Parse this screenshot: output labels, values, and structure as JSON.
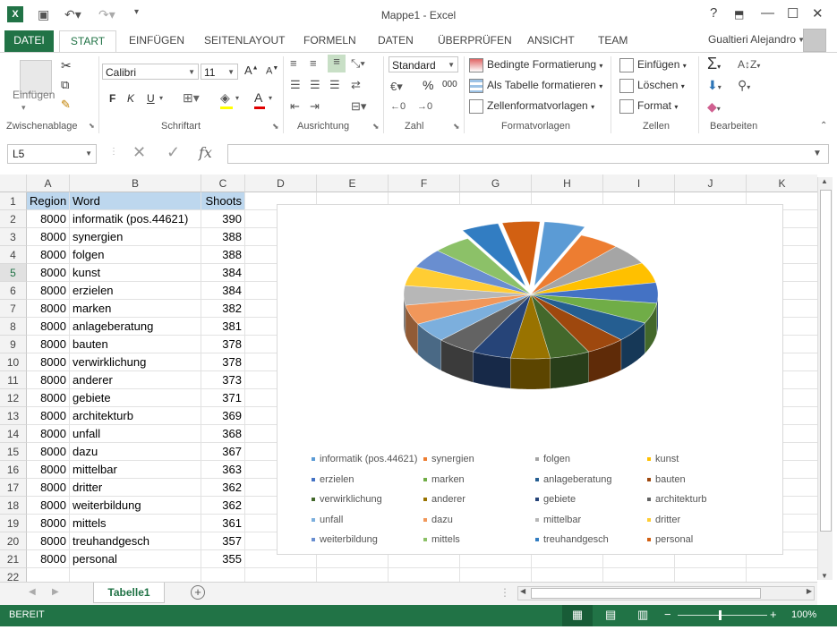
{
  "window": {
    "title": "Mappe1 - Excel",
    "user": "Gualtieri Alejandro",
    "help": "?",
    "min": "—",
    "max": "☐",
    "close": "✕"
  },
  "tabs": [
    "DATEI",
    "START",
    "EINFÜGEN",
    "SEITENLAYOUT",
    "FORMELN",
    "DATEN",
    "ÜBERPRÜFEN",
    "ANSICHT",
    "TEAM"
  ],
  "ribbon": {
    "paste_label": "Einfügen",
    "font_name": "Calibri",
    "font_size": "11",
    "bold": "F",
    "italic": "K",
    "underline": "U",
    "number_format": "Standard",
    "percent": "%",
    "thousands": "000",
    "cond_format": "Bedingte Formatierung",
    "as_table": "Als Tabelle formatieren",
    "cell_styles": "Zellenformatvorlagen",
    "insert": "Einfügen",
    "delete": "Löschen",
    "format": "Format",
    "groups": {
      "clipboard": "Zwischenablage",
      "font": "Schriftart",
      "alignment": "Ausrichtung",
      "number": "Zahl",
      "styles": "Formatvorlagen",
      "cells": "Zellen",
      "editing": "Bearbeiten"
    }
  },
  "formula_bar": {
    "name_box": "L5",
    "fx": "fx",
    "value": ""
  },
  "columns": [
    "A",
    "B",
    "C",
    "D",
    "E",
    "F",
    "G",
    "H",
    "I",
    "J",
    "K"
  ],
  "table": {
    "headers": [
      "Region",
      "Word",
      "Shoots"
    ],
    "rows": [
      [
        "8000",
        "informatik (pos.44621)",
        "390"
      ],
      [
        "8000",
        "synergien",
        "388"
      ],
      [
        "8000",
        "folgen",
        "388"
      ],
      [
        "8000",
        "kunst",
        "384"
      ],
      [
        "8000",
        "erzielen",
        "384"
      ],
      [
        "8000",
        "marken",
        "382"
      ],
      [
        "8000",
        "anlageberatung",
        "381"
      ],
      [
        "8000",
        "bauten",
        "378"
      ],
      [
        "8000",
        "verwirklichung",
        "378"
      ],
      [
        "8000",
        "anderer",
        "373"
      ],
      [
        "8000",
        "gebiete",
        "371"
      ],
      [
        "8000",
        "architekturb",
        "369"
      ],
      [
        "8000",
        "unfall",
        "368"
      ],
      [
        "8000",
        "dazu",
        "367"
      ],
      [
        "8000",
        "mittelbar",
        "363"
      ],
      [
        "8000",
        "dritter",
        "362"
      ],
      [
        "8000",
        "weiterbildung",
        "362"
      ],
      [
        "8000",
        "mittels",
        "361"
      ],
      [
        "8000",
        "treuhandgesch",
        "357"
      ],
      [
        "8000",
        "personal",
        "355"
      ]
    ]
  },
  "chart_data": {
    "type": "pie",
    "categories": [
      "informatik (pos.44621)",
      "synergien",
      "folgen",
      "kunst",
      "erzielen",
      "marken",
      "anlageberatung",
      "bauten",
      "verwirklichung",
      "anderer",
      "gebiete",
      "architekturb",
      "unfall",
      "dazu",
      "mittelbar",
      "dritter",
      "weiterbildung",
      "mittels",
      "treuhandgesch",
      "personal"
    ],
    "values": [
      390,
      388,
      388,
      384,
      384,
      382,
      381,
      378,
      378,
      373,
      371,
      369,
      368,
      367,
      363,
      362,
      362,
      361,
      357,
      355
    ],
    "colors": [
      "#5b9bd5",
      "#ed7d31",
      "#a5a5a5",
      "#ffc000",
      "#4472c4",
      "#70ad47",
      "#255e91",
      "#9e480e",
      "#43682b",
      "#997300",
      "#264478",
      "#636363",
      "#7cafdd",
      "#f1975a",
      "#b7b7b7",
      "#ffcd33",
      "#698ed0",
      "#8cc168",
      "#327dc2",
      "#d26012"
    ],
    "exploded": [
      0,
      19,
      18
    ],
    "legend_position": "bottom"
  },
  "sheet": {
    "tab": "Tabelle1",
    "add": "+"
  },
  "status": {
    "ready": "BEREIT",
    "zoom": "100%"
  },
  "row_extra": "22"
}
